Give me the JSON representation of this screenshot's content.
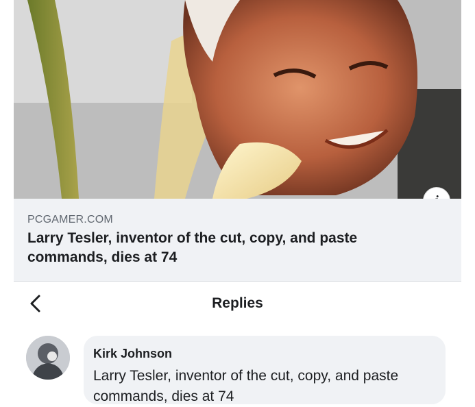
{
  "link_preview": {
    "domain": "PCGAMER.COM",
    "title": "Larry Tesler, inventor of the cut, copy, and paste commands, dies at 74",
    "info_label": "i"
  },
  "replies_header": {
    "title": "Replies"
  },
  "comment": {
    "author": "Kirk Johnson",
    "text": "Larry Tesler, inventor of the cut, copy, and paste commands, dies at 74"
  },
  "icons": {
    "back": "chevron-left-icon",
    "info": "info-icon",
    "avatar": "avatar"
  }
}
